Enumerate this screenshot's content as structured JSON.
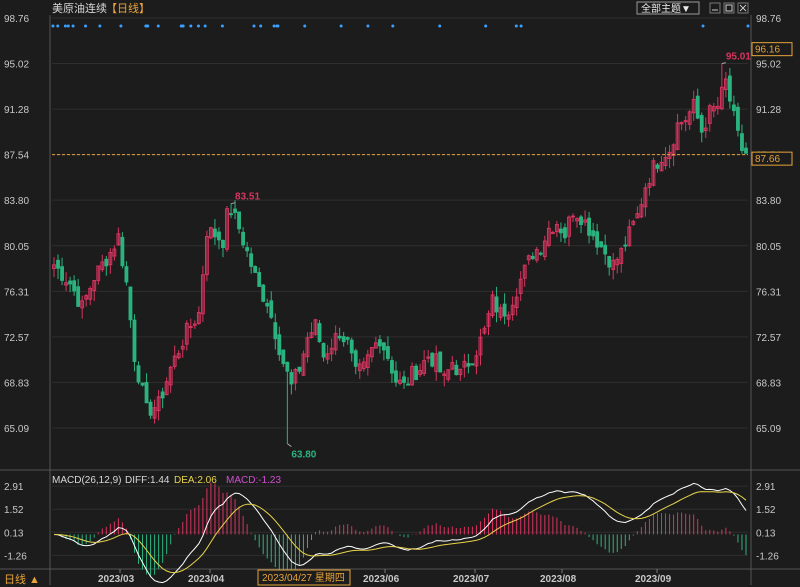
{
  "header": {
    "title": "美原油连续",
    "period": "【日线】",
    "menu_label": "全部主题▼",
    "window_icons": [
      "minimize-icon",
      "maximize-icon",
      "close-icon"
    ]
  },
  "footer": {
    "period_button": "日线 ▲",
    "cursor_date": "2023/04/27 星期四"
  },
  "colors": {
    "background": "#1c1c1c",
    "up": "#d8345f",
    "down": "#2bb37f",
    "grid": "#2e2e2e",
    "axis_text": "#c8c8c8",
    "dashed_line": "#e8a33a",
    "diff": "#ffffff",
    "dea": "#e8d44a",
    "macd_label": "#d050d0"
  },
  "chart_data": [
    {
      "type": "candlestick",
      "title": "美原油连续",
      "ylim": [
        61.8,
        98.76
      ],
      "y_ticks": [
        "98.76",
        "95.02",
        "91.28",
        "87.54",
        "83.80",
        "80.05",
        "76.31",
        "72.57",
        "68.83",
        "65.09"
      ],
      "x_ticks": [
        "2023/03",
        "2023/04",
        "2023/06",
        "2023/07",
        "2023/08",
        "2023/09"
      ],
      "current_price": "87.66",
      "right_top_label": "96.16",
      "dashed_line_value": 87.54,
      "annotations": [
        {
          "label": "83.51",
          "value": 83.51,
          "kind": "high"
        },
        {
          "label": "63.80",
          "value": 63.8,
          "kind": "low"
        },
        {
          "label": "95.01",
          "value": 95.01,
          "kind": "high"
        }
      ],
      "anchors": [
        [
          0,
          78.5
        ],
        [
          4,
          77.0
        ],
        [
          7,
          75.0
        ],
        [
          10,
          77.5
        ],
        [
          14,
          79.5
        ],
        [
          16,
          80.8
        ],
        [
          18,
          77.0
        ],
        [
          20,
          71.0
        ],
        [
          23,
          66.5
        ],
        [
          26,
          67.0
        ],
        [
          29,
          70.0
        ],
        [
          33,
          73.0
        ],
        [
          36,
          74.5
        ],
        [
          38,
          81.3
        ],
        [
          40,
          81.0
        ],
        [
          42,
          80.5
        ],
        [
          43,
          82.5
        ],
        [
          44,
          83.0
        ],
        [
          46,
          81.5
        ],
        [
          49,
          78.5
        ],
        [
          51,
          76.5
        ],
        [
          53,
          75.5
        ],
        [
          55,
          73.0
        ],
        [
          57,
          70.5
        ],
        [
          59,
          68.5
        ],
        [
          61,
          70.0
        ],
        [
          63,
          72.5
        ],
        [
          65,
          73.5
        ],
        [
          67,
          71.0
        ],
        [
          69,
          72.0
        ],
        [
          71,
          73.0
        ],
        [
          73,
          72.0
        ],
        [
          75,
          69.5
        ],
        [
          77,
          70.0
        ],
        [
          79,
          71.5
        ],
        [
          81,
          72.5
        ],
        [
          83,
          71.0
        ],
        [
          85,
          69.0
        ],
        [
          87,
          68.5
        ],
        [
          89,
          69.5
        ],
        [
          91,
          70.0
        ],
        [
          93,
          71.0
        ],
        [
          95,
          70.5
        ],
        [
          97,
          69.0
        ],
        [
          99,
          70.5
        ],
        [
          101,
          69.5
        ],
        [
          103,
          70.5
        ],
        [
          105,
          71.5
        ],
        [
          107,
          73.0
        ],
        [
          109,
          75.5
        ],
        [
          111,
          74.5
        ],
        [
          113,
          75.0
        ],
        [
          115,
          76.5
        ],
        [
          117,
          78.0
        ],
        [
          119,
          79.5
        ],
        [
          121,
          80.0
        ],
        [
          123,
          81.5
        ],
        [
          125,
          82.0
        ],
        [
          127,
          81.0
        ],
        [
          129,
          83.0
        ],
        [
          131,
          82.5
        ],
        [
          133,
          81.5
        ],
        [
          135,
          80.5
        ],
        [
          137,
          79.5
        ],
        [
          139,
          78.5
        ],
        [
          141,
          79.5
        ],
        [
          143,
          81.0
        ],
        [
          145,
          82.5
        ],
        [
          147,
          85.0
        ],
        [
          149,
          86.5
        ],
        [
          151,
          87.5
        ],
        [
          153,
          88.0
        ],
        [
          155,
          90.0
        ],
        [
          157,
          90.5
        ],
        [
          159,
          91.5
        ],
        [
          161,
          89.5
        ],
        [
          163,
          91.0
        ],
        [
          165,
          91.5
        ],
        [
          167,
          93.5
        ],
        [
          168,
          92.0
        ],
        [
          169,
          90.5
        ],
        [
          170,
          89.0
        ],
        [
          171,
          88.0
        ],
        [
          172,
          87.66
        ]
      ],
      "wicks": [
        {
          "index": 44,
          "high": 83.51
        },
        {
          "index": 58,
          "low": 63.8
        },
        {
          "index": 166,
          "high": 95.01
        }
      ]
    },
    {
      "type": "macd",
      "params": "MACD(26,12,9)",
      "legend": {
        "diff": "DIFF:1.44",
        "dea": "DEA:2.06",
        "macd": "MACD:-1.23"
      },
      "ylim": [
        -1.9,
        3.4
      ],
      "y_ticks": [
        "2.91",
        "1.52",
        "0.13",
        "-1.26"
      ],
      "diff_last": 1.44,
      "dea_last": 2.06,
      "macd_last": -1.23
    }
  ]
}
